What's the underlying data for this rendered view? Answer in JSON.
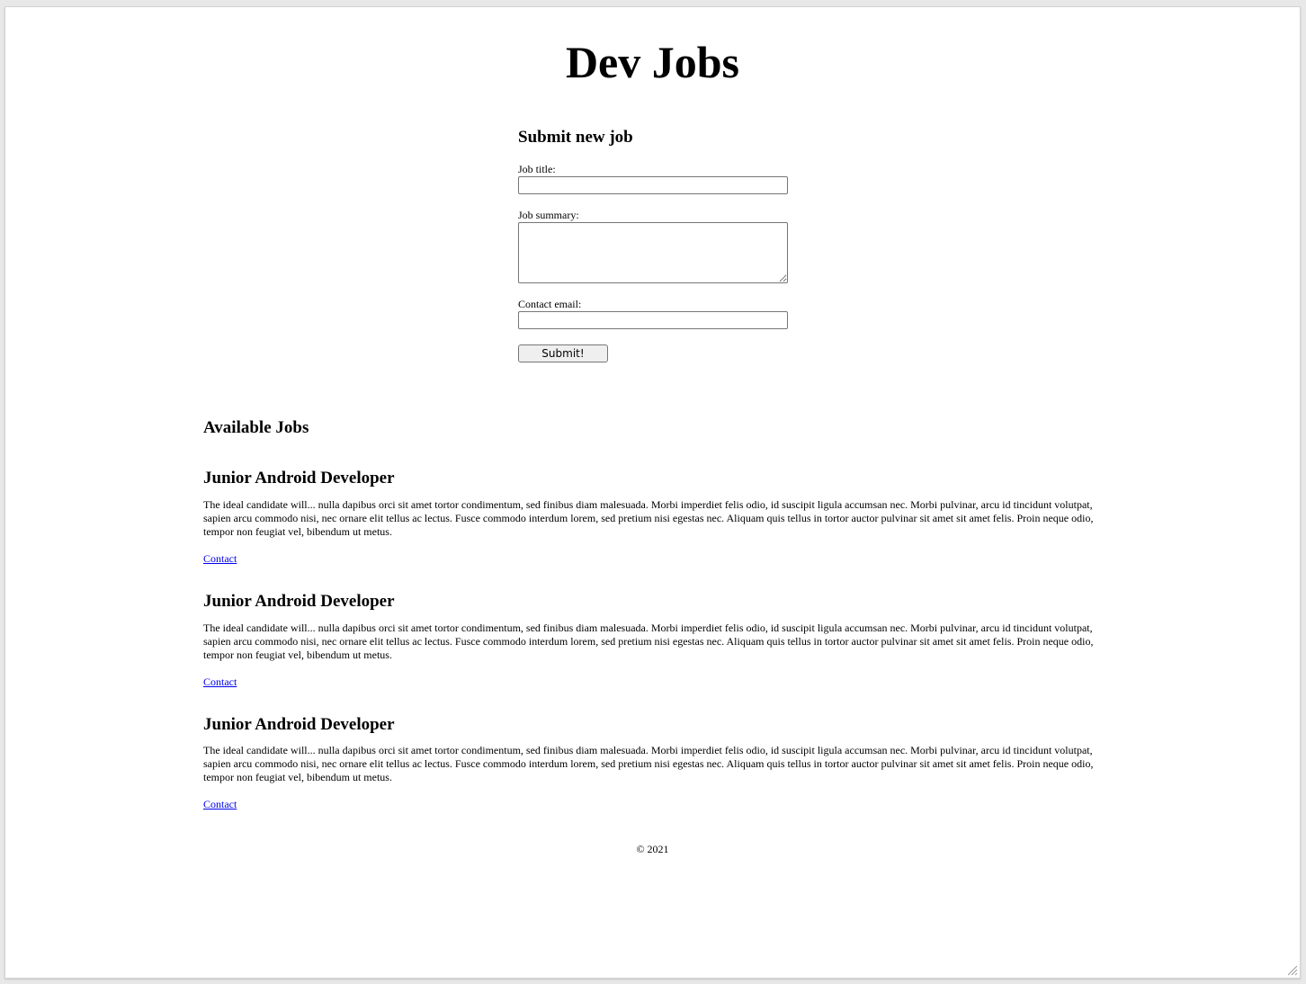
{
  "header": {
    "title": "Dev Jobs"
  },
  "form": {
    "heading": "Submit new job",
    "job_title_label": "Job title:",
    "job_title_value": "",
    "job_summary_label": "Job summary:",
    "job_summary_value": "",
    "contact_email_label": "Contact email:",
    "contact_email_value": "",
    "submit_label": "Submit!"
  },
  "jobs": {
    "heading": "Available Jobs",
    "items": [
      {
        "title": "Junior Android Developer",
        "summary": "The ideal candidate will... nulla dapibus orci sit amet tortor condimentum, sed finibus diam malesuada. Morbi imperdiet felis odio, id suscipit ligula accumsan nec. Morbi pulvinar, arcu id tincidunt volutpat, sapien arcu commodo nisi, nec ornare elit tellus ac lectus. Fusce commodo interdum lorem, sed pretium nisi egestas nec. Aliquam quis tellus in tortor auctor pulvinar sit amet sit amet felis. Proin neque odio, tempor non feugiat vel, bibendum ut metus.",
        "contact_label": "Contact"
      },
      {
        "title": "Junior Android Developer",
        "summary": "The ideal candidate will... nulla dapibus orci sit amet tortor condimentum, sed finibus diam malesuada. Morbi imperdiet felis odio, id suscipit ligula accumsan nec. Morbi pulvinar, arcu id tincidunt volutpat, sapien arcu commodo nisi, nec ornare elit tellus ac lectus. Fusce commodo interdum lorem, sed pretium nisi egestas nec. Aliquam quis tellus in tortor auctor pulvinar sit amet sit amet felis. Proin neque odio, tempor non feugiat vel, bibendum ut metus.",
        "contact_label": "Contact"
      },
      {
        "title": "Junior Android Developer",
        "summary": "The ideal candidate will... nulla dapibus orci sit amet tortor condimentum, sed finibus diam malesuada. Morbi imperdiet felis odio, id suscipit ligula accumsan nec. Morbi pulvinar, arcu id tincidunt volutpat, sapien arcu commodo nisi, nec ornare elit tellus ac lectus. Fusce commodo interdum lorem, sed pretium nisi egestas nec. Aliquam quis tellus in tortor auctor pulvinar sit amet sit amet felis. Proin neque odio, tempor non feugiat vel, bibendum ut metus.",
        "contact_label": "Contact"
      }
    ]
  },
  "footer": {
    "copyright": "© 2021"
  },
  "colors": {
    "link": "#0000ee",
    "background": "#ffffff",
    "text": "#000000"
  },
  "icons": {
    "textarea_grip": "resize-grip-icon",
    "window_grip": "resize-grip-icon"
  }
}
